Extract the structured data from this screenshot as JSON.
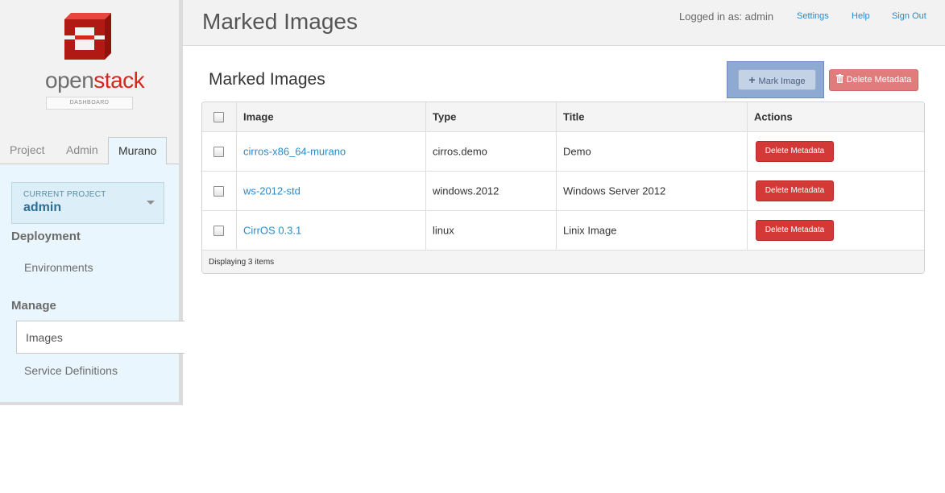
{
  "brand": {
    "name_part1": "open",
    "name_part2": "stack",
    "subtitle": "DASHBOARD",
    "logo_color": "#d9261c"
  },
  "header": {
    "title": "Marked Images",
    "logged_in": "Logged in as: admin",
    "links": {
      "settings": "Settings",
      "help": "Help",
      "sign_out": "Sign Out"
    }
  },
  "sidebar": {
    "tabs": [
      {
        "label": "Project"
      },
      {
        "label": "Admin"
      },
      {
        "label": "Murano",
        "active": true
      }
    ],
    "current_project": {
      "label": "CURRENT PROJECT",
      "value": "admin"
    },
    "sections": [
      {
        "heading": "Deployment",
        "items": [
          {
            "label": "Environments"
          }
        ]
      },
      {
        "heading": "Manage",
        "items": [
          {
            "label": "Images",
            "active": true
          },
          {
            "label": "Service Definitions"
          }
        ]
      }
    ]
  },
  "main": {
    "section_title": "Marked Images",
    "buttons": {
      "mark_image": "Mark Image",
      "delete_metadata": "Delete Metadata"
    },
    "table": {
      "columns": [
        "Image",
        "Type",
        "Title",
        "Actions"
      ],
      "rows": [
        {
          "image": "cirros-x86_64-murano",
          "type": "cirros.demo",
          "title": "Demo",
          "action": "Delete Metadata"
        },
        {
          "image": "ws-2012-std",
          "type": "windows.2012",
          "title": "Windows Server 2012",
          "action": "Delete Metadata"
        },
        {
          "image": "CirrOS 0.3.1",
          "type": "linux",
          "title": "Linix Image",
          "action": "Delete Metadata"
        }
      ],
      "footer": "Displaying 3 items"
    }
  },
  "colors": {
    "accent_link": "#2a8ac8",
    "danger": "#d33a37",
    "highlight": "#8eaad3"
  },
  "icons": {
    "mark_image": "plus-icon",
    "delete_metadata": "trash-icon",
    "project_switch": "caret-down-icon"
  }
}
